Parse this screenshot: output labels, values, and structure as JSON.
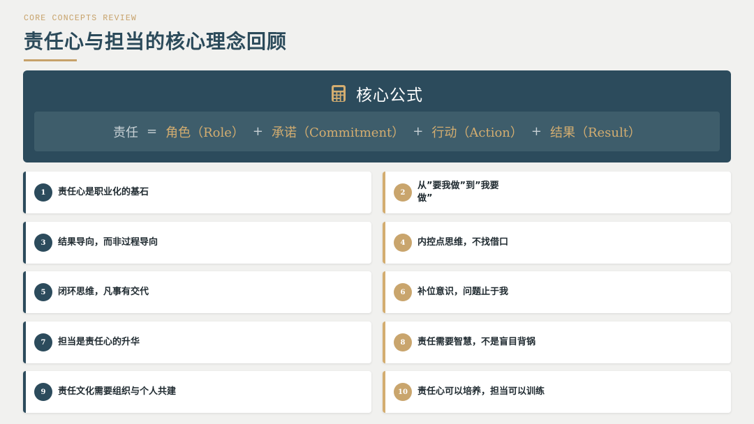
{
  "header": {
    "eyebrow": "CORE CONCEPTS REVIEW",
    "title": "责任心与担当的核心理念回顾"
  },
  "formula": {
    "icon": "calculator-icon",
    "title": "核心公式",
    "base": "责任",
    "equals": "=",
    "plus": "+",
    "terms": [
      "角色（Role）",
      "承诺（Commitment）",
      "行动（Action）",
      "结果（Result）"
    ]
  },
  "concepts": [
    {
      "num": "1",
      "text": "责任心是职业化的基石"
    },
    {
      "num": "2",
      "text": "从”要我做”到”我要做”"
    },
    {
      "num": "3",
      "text": "结果导向，而非过程导向"
    },
    {
      "num": "4",
      "text": "内控点思维，不找借口"
    },
    {
      "num": "5",
      "text": "闭环思维，凡事有交代"
    },
    {
      "num": "6",
      "text": "补位意识，问题止于我"
    },
    {
      "num": "7",
      "text": "担当是责任心的升华"
    },
    {
      "num": "8",
      "text": "责任需要智慧，不是盲目背锅"
    },
    {
      "num": "9",
      "text": "责任文化需要组织与个人共建"
    },
    {
      "num": "10",
      "text": "责任心可以培养，担当可以训练"
    }
  ],
  "colors": {
    "navy": "#2c4b5c",
    "gold": "#d3ad70",
    "background": "#f1f1ef"
  }
}
